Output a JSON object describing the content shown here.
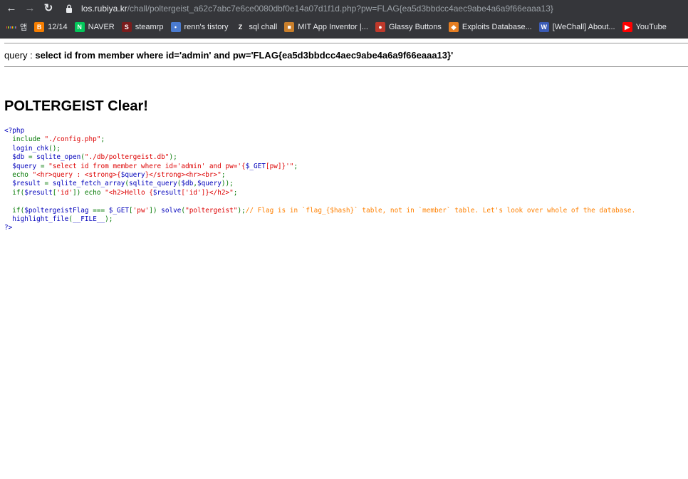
{
  "browser": {
    "url_host": "los.rubiya.kr",
    "url_path": "/chall/poltergeist_a62c7abc7e6ce0080dbf0e14a07d1f1d.php?pw=FLAG{ea5d3bbdcc4aec9abe4a6a9f66eaaa13}",
    "bookmarks": [
      {
        "label": "앱",
        "icon": "apps-grid-icon"
      },
      {
        "label": "12/14",
        "icon": "blogger-icon",
        "color": "#f57d00",
        "glyph": "B"
      },
      {
        "label": "NAVER",
        "icon": "naver-icon",
        "color": "#03c75a",
        "glyph": "N"
      },
      {
        "label": "steamrp",
        "icon": "steamrp-icon",
        "color": "#7a1c1c",
        "glyph": "S"
      },
      {
        "label": "renn's tistory",
        "icon": "tistory-icon",
        "color": "#4a7bd0",
        "glyph": "•"
      },
      {
        "label": "sql chall",
        "icon": "z-icon",
        "color": "#35363a",
        "glyph": "Z"
      },
      {
        "label": "MIT App Inventor |...",
        "icon": "app-inventor-icon",
        "color": "#c97f2b",
        "glyph": "■"
      },
      {
        "label": "Glassy Buttons",
        "icon": "glassy-buttons-icon",
        "color": "#c0392b",
        "glyph": "●"
      },
      {
        "label": "Exploits Database...",
        "icon": "exploit-db-icon",
        "color": "#e67e22",
        "glyph": "◆"
      },
      {
        "label": "[WeChall] About...",
        "icon": "wechall-icon",
        "color": "#3b5bb5",
        "glyph": "W"
      },
      {
        "label": "YouTube",
        "icon": "youtube-icon",
        "color": "#ff0000",
        "glyph": "▶"
      }
    ]
  },
  "page": {
    "query_prefix": "query : ",
    "query": "select id from member where id='admin' and pw='FLAG{ea5d3bbdcc4aec9abe4a6a9f66eaaa13}'",
    "heading": "POLTERGEIST Clear!",
    "code_lines": [
      [
        {
          "t": "<?php",
          "c": "kw"
        }
      ],
      [
        {
          "t": "  include ",
          "c": "op"
        },
        {
          "t": "\"./config.php\"",
          "c": "str"
        },
        {
          "t": ";",
          "c": "op"
        }
      ],
      [
        {
          "t": "  login_chk",
          "c": "kw"
        },
        {
          "t": "();",
          "c": "op"
        }
      ],
      [
        {
          "t": "  $db ",
          "c": "kw"
        },
        {
          "t": "= ",
          "c": "op"
        },
        {
          "t": "sqlite_open",
          "c": "kw"
        },
        {
          "t": "(",
          "c": "op"
        },
        {
          "t": "\"./db/poltergeist.db\"",
          "c": "str"
        },
        {
          "t": ");",
          "c": "op"
        }
      ],
      [
        {
          "t": "  $query ",
          "c": "kw"
        },
        {
          "t": "= ",
          "c": "op"
        },
        {
          "t": "\"select id from member where id='admin' and pw='{",
          "c": "str"
        },
        {
          "t": "$_GET",
          "c": "kw"
        },
        {
          "t": "[pw]",
          "c": "str"
        },
        {
          "t": "}'\"",
          "c": "str"
        },
        {
          "t": ";",
          "c": "op"
        }
      ],
      [
        {
          "t": "  echo ",
          "c": "op"
        },
        {
          "t": "\"<hr>query : <strong>{",
          "c": "str"
        },
        {
          "t": "$query",
          "c": "kw"
        },
        {
          "t": "}</strong><hr><br>\"",
          "c": "str"
        },
        {
          "t": ";",
          "c": "op"
        }
      ],
      [
        {
          "t": "  $result ",
          "c": "kw"
        },
        {
          "t": "= ",
          "c": "op"
        },
        {
          "t": "sqlite_fetch_array",
          "c": "kw"
        },
        {
          "t": "(",
          "c": "op"
        },
        {
          "t": "sqlite_query",
          "c": "kw"
        },
        {
          "t": "(",
          "c": "op"
        },
        {
          "t": "$db",
          "c": "kw"
        },
        {
          "t": ",",
          "c": "op"
        },
        {
          "t": "$query",
          "c": "kw"
        },
        {
          "t": "));",
          "c": "op"
        }
      ],
      [
        {
          "t": "  if(",
          "c": "op"
        },
        {
          "t": "$result",
          "c": "kw"
        },
        {
          "t": "[",
          "c": "op"
        },
        {
          "t": "'id'",
          "c": "str"
        },
        {
          "t": "]) echo ",
          "c": "op"
        },
        {
          "t": "\"<h2>Hello {",
          "c": "str"
        },
        {
          "t": "$result",
          "c": "kw"
        },
        {
          "t": "[",
          "c": "str"
        },
        {
          "t": "'id'",
          "c": "str"
        },
        {
          "t": "]}</h2>\"",
          "c": "str"
        },
        {
          "t": ";",
          "c": "op"
        }
      ],
      [
        {
          "t": "",
          "c": "op"
        }
      ],
      [
        {
          "t": "  if(",
          "c": "op"
        },
        {
          "t": "$poltergeistFlag ",
          "c": "kw"
        },
        {
          "t": "=== ",
          "c": "op"
        },
        {
          "t": "$_GET",
          "c": "kw"
        },
        {
          "t": "[",
          "c": "op"
        },
        {
          "t": "'pw'",
          "c": "str"
        },
        {
          "t": "]) ",
          "c": "op"
        },
        {
          "t": "solve",
          "c": "kw"
        },
        {
          "t": "(",
          "c": "op"
        },
        {
          "t": "\"poltergeist\"",
          "c": "str"
        },
        {
          "t": ");",
          "c": "op"
        },
        {
          "t": "// Flag is in `flag_{$hash}` table, not in `member` table. Let's look over whole of the database.",
          "c": "cm"
        }
      ],
      [
        {
          "t": "  highlight_file",
          "c": "kw"
        },
        {
          "t": "(",
          "c": "op"
        },
        {
          "t": "__FILE__",
          "c": "kw"
        },
        {
          "t": ");",
          "c": "op"
        }
      ],
      [
        {
          "t": "?>",
          "c": "kw"
        }
      ]
    ]
  }
}
